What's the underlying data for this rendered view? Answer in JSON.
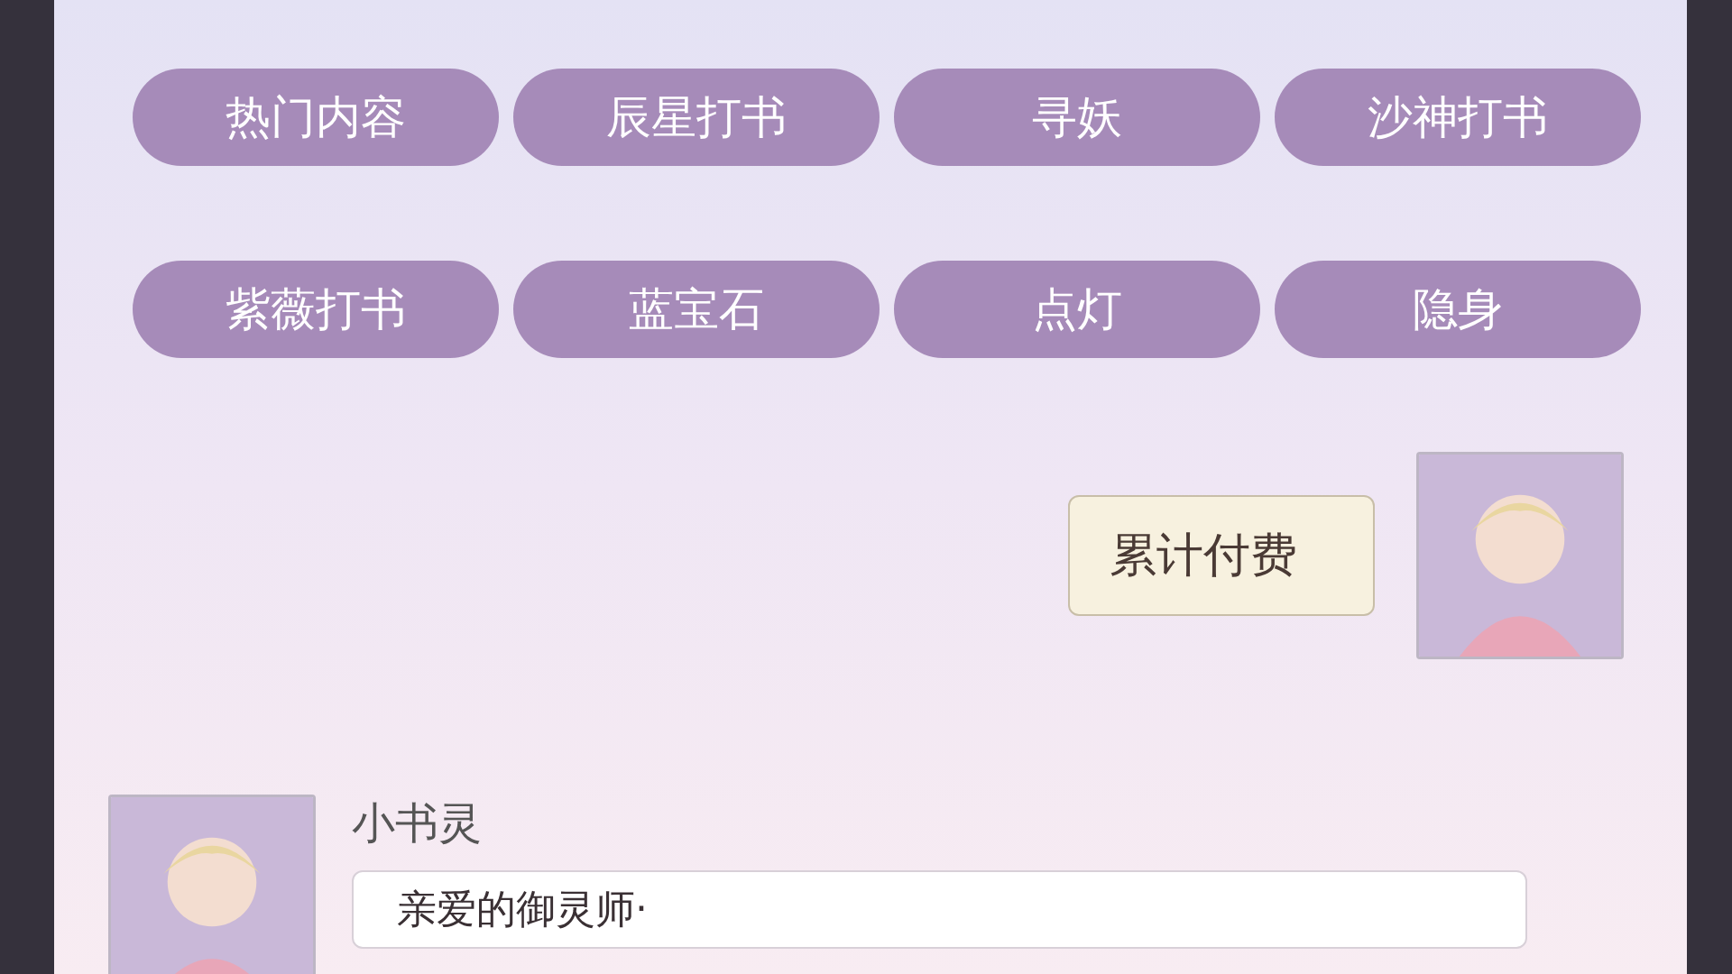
{
  "menu_buttons": [
    {
      "label": "热门内容"
    },
    {
      "label": "辰星打书"
    },
    {
      "label": "寻妖"
    },
    {
      "label": "沙神打书"
    },
    {
      "label": "紫薇打书"
    },
    {
      "label": "蓝宝石"
    },
    {
      "label": "点灯"
    },
    {
      "label": "隐身"
    }
  ],
  "messages": [
    {
      "kind": "sent",
      "text": "累计付费"
    },
    {
      "kind": "received",
      "sender": "小书灵",
      "text": "亲爱的御灵师·"
    }
  ]
}
